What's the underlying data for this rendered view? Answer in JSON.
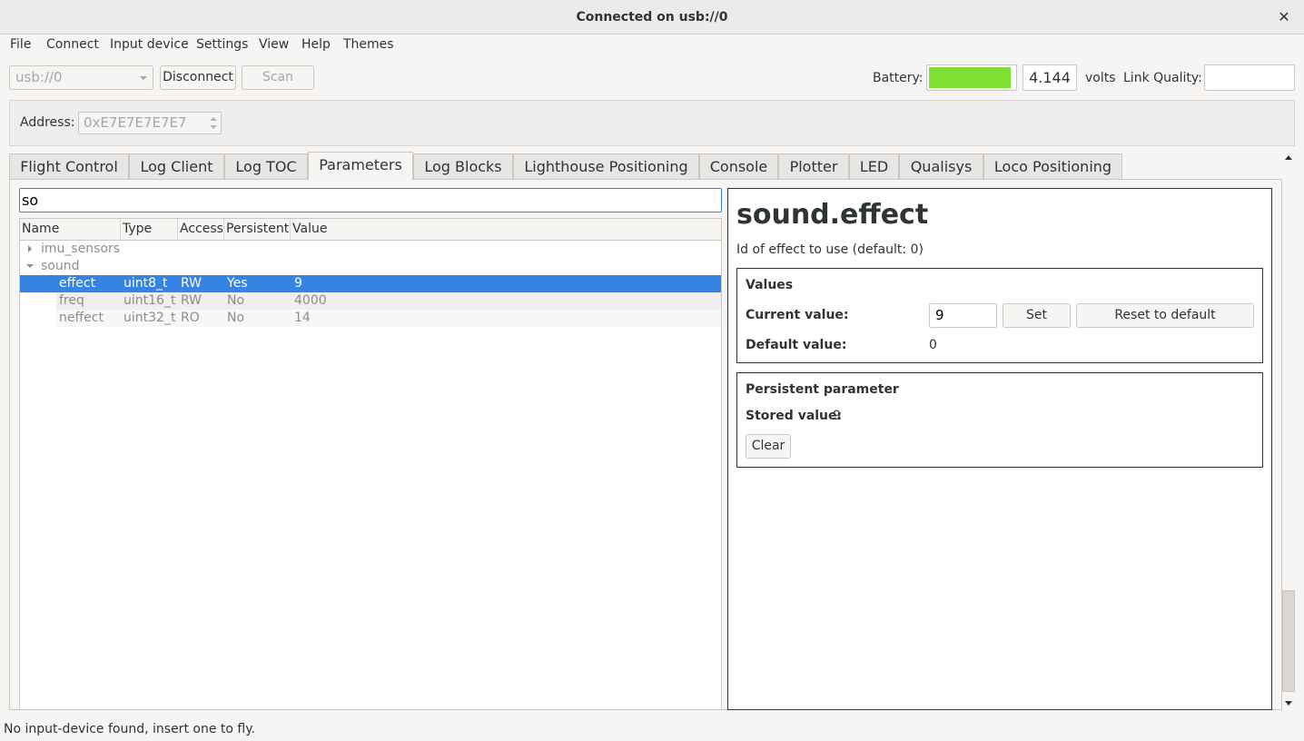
{
  "window": {
    "title": "Connected on usb://0"
  },
  "menu": [
    "File",
    "Connect",
    "Input device",
    "Settings",
    "View",
    "Help",
    "Themes"
  ],
  "toolbar": {
    "uri": "usb://0",
    "disconnect_label": "Disconnect",
    "scan_label": "Scan",
    "battery_label": "Battery:",
    "battery_level_pct": 96,
    "battery_color": "#7de033",
    "voltage": "4.144",
    "volts_label": "volts",
    "link_quality_label": "Link Quality:",
    "link_quality_value": ""
  },
  "address": {
    "label": "Address:",
    "value": "0xE7E7E7E7E7"
  },
  "tabs": [
    "Flight Control",
    "Log Client",
    "Log TOC",
    "Parameters",
    "Log Blocks",
    "Lighthouse Positioning",
    "Console",
    "Plotter",
    "LED",
    "Qualisys",
    "Loco Positioning"
  ],
  "active_tab": "Parameters",
  "params": {
    "search": "so",
    "columns": [
      "Name",
      "Type",
      "Access",
      "Persistent",
      "Value"
    ],
    "groups": [
      {
        "name": "imu_sensors",
        "expanded": false
      },
      {
        "name": "sound",
        "expanded": true
      }
    ],
    "rows": [
      {
        "name": "effect",
        "type": "uint8_t",
        "access": "RW",
        "persistent": "Yes",
        "value": "9"
      },
      {
        "name": "freq",
        "type": "uint16_t",
        "access": "RW",
        "persistent": "No",
        "value": "4000"
      },
      {
        "name": "neffect",
        "type": "uint32_t",
        "access": "RO",
        "persistent": "No",
        "value": "14"
      }
    ]
  },
  "detail": {
    "title": "sound.effect",
    "description": "Id of effect to use (default: 0)",
    "values_title": "Values",
    "current_label": "Current value:",
    "current_value": "9",
    "set_label": "Set",
    "reset_label": "Reset to default",
    "default_label": "Default value:",
    "default_value": "0",
    "persistent_title": "Persistent parameter",
    "stored_label": "Stored value:",
    "stored_value": "9",
    "clear_label": "Clear"
  },
  "status": {
    "text": "No input-device found, insert one to fly."
  }
}
